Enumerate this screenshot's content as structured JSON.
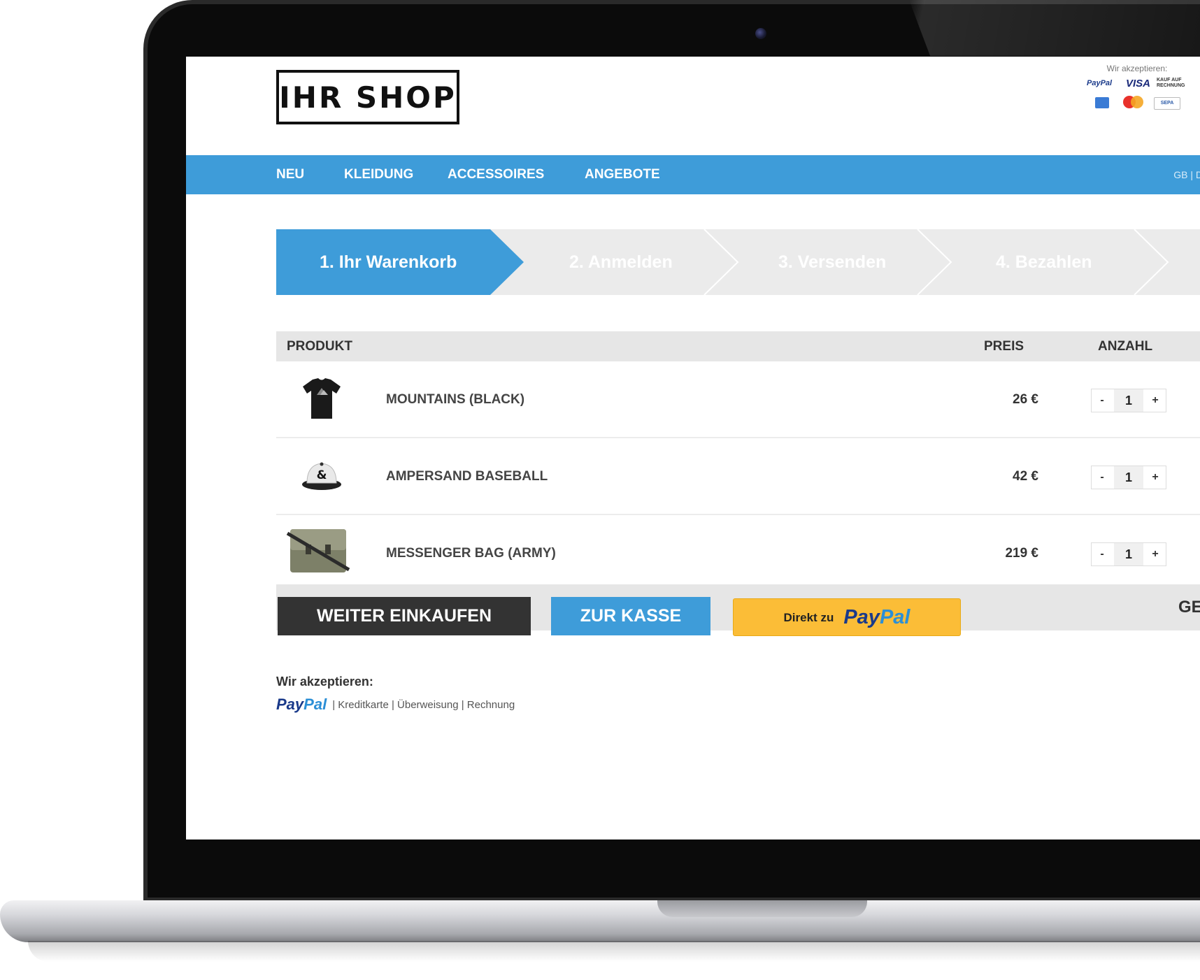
{
  "header": {
    "logo_text": "IHR SHOP",
    "payments_label": "Wir akzeptieren:",
    "payment_logos": [
      "PayPal",
      "VISA",
      "KAUF AUF RECHNUNG",
      "American Express",
      "Mastercard",
      "SEPA"
    ],
    "payment_logo_text": {
      "paypal": "PayPal",
      "visa": "VISA",
      "kauf": "KAUF AUF RECHNUNG",
      "sepa": "SEPA"
    }
  },
  "nav": {
    "items": [
      {
        "label": "NEU"
      },
      {
        "label": "KLEIDUNG"
      },
      {
        "label": "ACCESSOIRES"
      },
      {
        "label": "ANGEBOTE"
      }
    ],
    "language": "GB | D"
  },
  "steps": [
    {
      "label": "1. Ihr Warenkorb",
      "active": true
    },
    {
      "label": "2. Anmelden",
      "active": false
    },
    {
      "label": "3. Versenden",
      "active": false
    },
    {
      "label": "4. Bezahlen",
      "active": false
    }
  ],
  "cart": {
    "columns": {
      "product": "PRODUKT",
      "price": "PREIS",
      "quantity": "ANZAHL"
    },
    "items": [
      {
        "name": "MOUNTAINS (BLACK)",
        "price": "26 €",
        "quantity": "1",
        "icon": "tshirt-icon"
      },
      {
        "name": "AMPERSAND BASEBALL",
        "price": "42 €",
        "quantity": "1",
        "icon": "cap-icon"
      },
      {
        "name": "MESSENGER BAG (ARMY)",
        "price": "219 €",
        "quantity": "1",
        "icon": "bag-icon"
      }
    ],
    "minus_label": "-",
    "plus_label": "+",
    "total_label": "GE"
  },
  "actions": {
    "continue_label": "WEITER EINKAUFEN",
    "checkout_label": "ZUR KASSE",
    "paypal_prefix": "Direkt zu",
    "paypal_pay": "Pay",
    "paypal_pal": "Pal"
  },
  "footer": {
    "accept_title": "Wir akzeptieren:",
    "paypal_pay": "Pay",
    "paypal_pal": "Pal",
    "methods": "| Kreditkarte | Überweisung | Rechnung"
  },
  "colors": {
    "primary": "#3e9cd9",
    "dark_button": "#333333",
    "paypal_button": "#fbbd37",
    "step_inactive": "#ebebeb"
  }
}
